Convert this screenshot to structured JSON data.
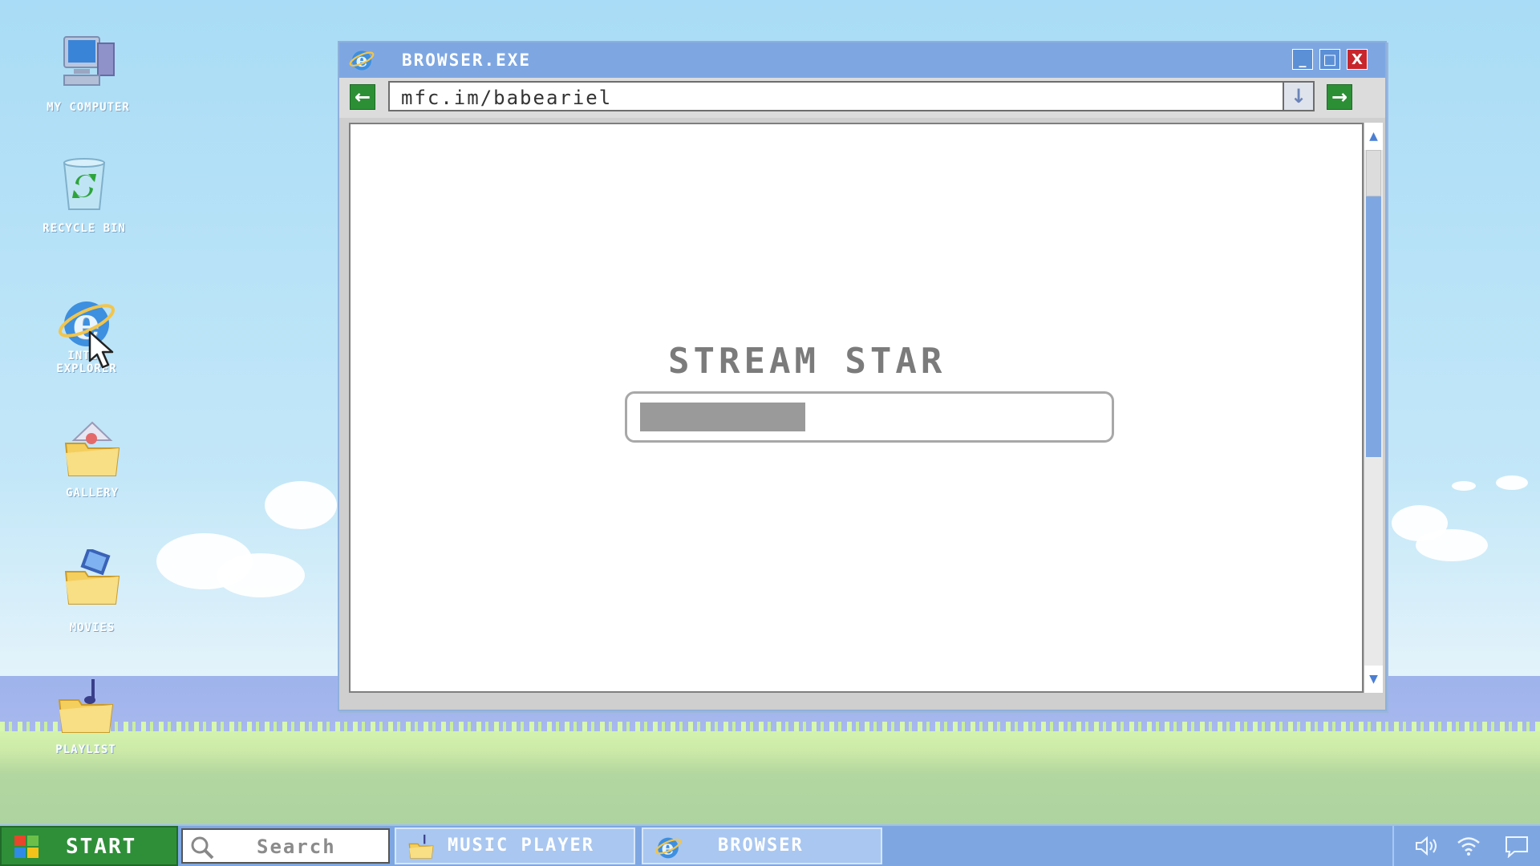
{
  "desktop": {
    "icons": [
      {
        "label": "MY COMPUTER"
      },
      {
        "label": "RECYCLE BIN"
      },
      {
        "label": "INTER",
        "label2": "EXPLORER"
      },
      {
        "label": "GALLERY"
      },
      {
        "label": "MOVIES"
      },
      {
        "label": "PLAYLIST"
      }
    ]
  },
  "window": {
    "title": "BROWSER.EXE",
    "buttons": {
      "minimize": "_",
      "maximize": "□",
      "close": "X"
    },
    "address": "mfc.im/babeariel",
    "page": {
      "heading": "STREAM STAR",
      "progress_percent": 36
    }
  },
  "taskbar": {
    "start_label": "START",
    "search_placeholder": "Search",
    "items": [
      {
        "label": "MUSIC PLAYER"
      },
      {
        "label": "BROWSER"
      }
    ]
  },
  "colors": {
    "titlebar": "#7ea7e2",
    "start": "#2e8f38",
    "close": "#c8262c",
    "nav_green": "#2c8f35"
  },
  "icons": [
    "computer-icon",
    "recycle-bin-icon",
    "internet-explorer-icon",
    "gallery-folder-icon",
    "movies-folder-icon",
    "playlist-folder-icon",
    "mouse-cursor-icon",
    "volume-icon",
    "wifi-icon",
    "notifications-icon",
    "search-icon",
    "windows-logo-icon"
  ]
}
